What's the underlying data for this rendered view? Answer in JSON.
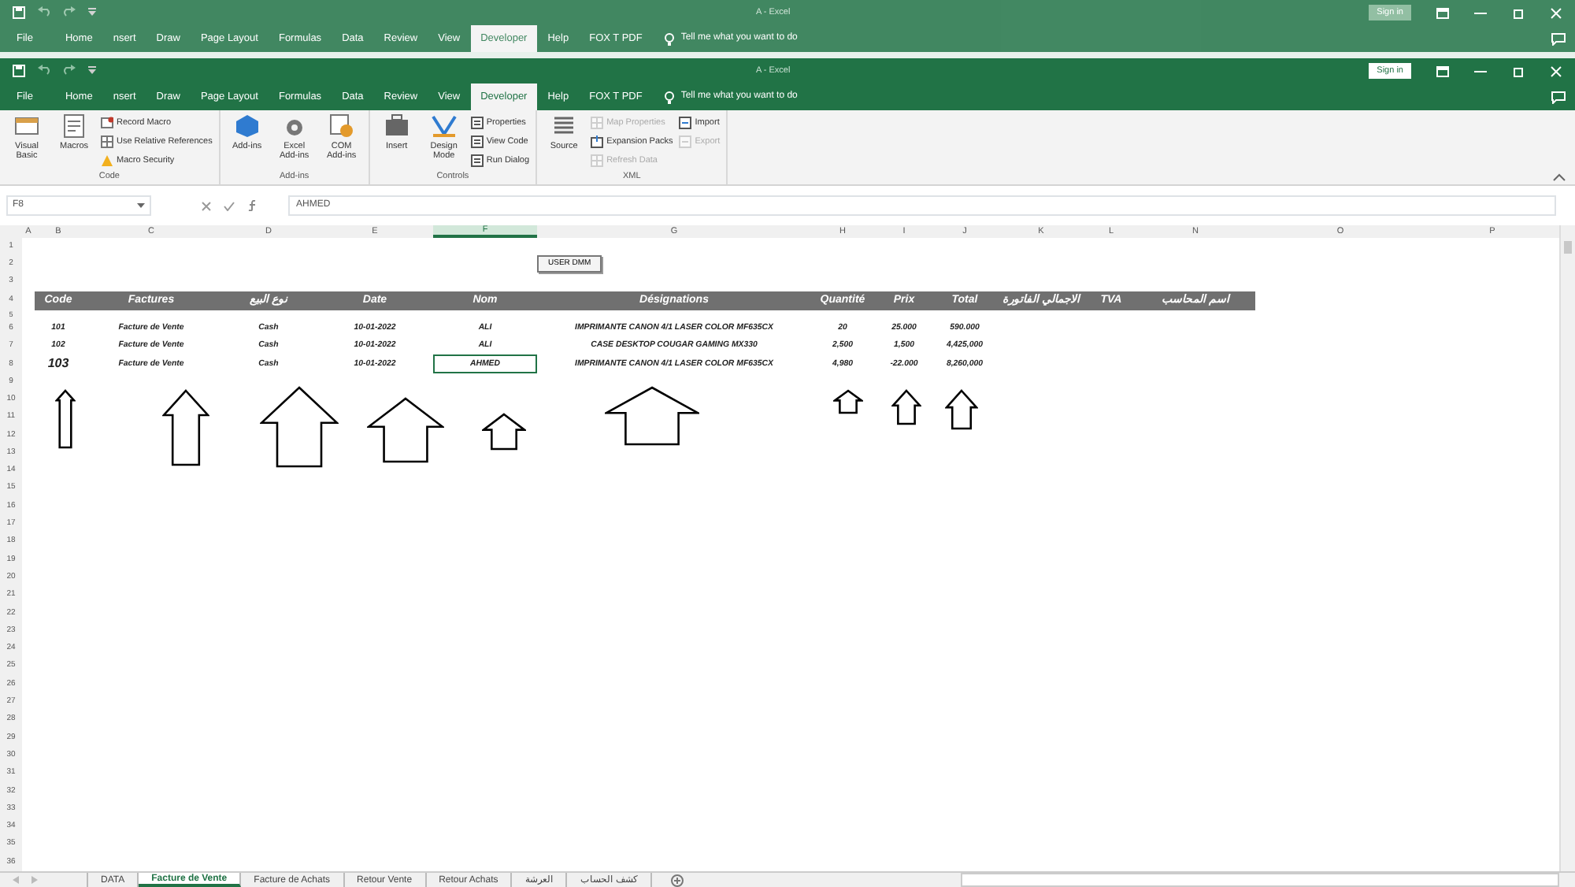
{
  "background_window": {
    "title": "A - Excel",
    "sign_in": "Sign in",
    "tell_me": "Tell me what you want to do",
    "tabs": [
      {
        "label": "File",
        "selected": false
      },
      {
        "label": "Home",
        "selected": false
      },
      {
        "label": "nsert",
        "selected": false
      },
      {
        "label": "Draw",
        "selected": false
      },
      {
        "label": "Page Layout",
        "selected": false
      },
      {
        "label": "Formulas",
        "selected": false
      },
      {
        "label": "Data",
        "selected": false
      },
      {
        "label": "Review",
        "selected": false
      },
      {
        "label": "View",
        "selected": false
      },
      {
        "label": "Developer",
        "selected": true
      },
      {
        "label": "Help",
        "selected": false
      },
      {
        "label": "FOX T PDF",
        "selected": false
      }
    ]
  },
  "window": {
    "title": "A - Excel",
    "sign_in": "Sign in",
    "tell_me": "Tell me what you want to do",
    "tabs": [
      {
        "label": "File",
        "selected": false
      },
      {
        "label": "Home",
        "selected": false
      },
      {
        "label": "nsert",
        "selected": false
      },
      {
        "label": "Draw",
        "selected": false
      },
      {
        "label": "Page Layout",
        "selected": false
      },
      {
        "label": "Formulas",
        "selected": false
      },
      {
        "label": "Data",
        "selected": false
      },
      {
        "label": "Review",
        "selected": false
      },
      {
        "label": "View",
        "selected": false
      },
      {
        "label": "Developer",
        "selected": true
      },
      {
        "label": "Help",
        "selected": false
      },
      {
        "label": "FOX T PDF",
        "selected": false
      }
    ]
  },
  "ribbon_groups": [
    {
      "label": "Code",
      "items": [
        {
          "label": "Visual Basic",
          "kind": "large",
          "disabled": false
        },
        {
          "label": "Macros",
          "kind": "large",
          "disabled": false
        },
        {
          "label": "Record Macro",
          "kind": "small",
          "disabled": false
        },
        {
          "label": "Use Relative References",
          "kind": "small",
          "disabled": false
        },
        {
          "label": "Macro Security",
          "kind": "small",
          "disabled": false
        }
      ]
    },
    {
      "label": "Add-ins",
      "items": [
        {
          "label": "Add-ins",
          "kind": "large",
          "disabled": false
        },
        {
          "label": "Excel Add-ins",
          "kind": "large",
          "disabled": false
        },
        {
          "label": "COM Add-ins",
          "kind": "large",
          "disabled": false
        }
      ]
    },
    {
      "label": "Controls",
      "items": [
        {
          "label": "Insert",
          "kind": "large",
          "disabled": false
        },
        {
          "label": "Design Mode",
          "kind": "large",
          "disabled": false
        },
        {
          "label": "Properties",
          "kind": "small",
          "disabled": false
        },
        {
          "label": "View Code",
          "kind": "small",
          "disabled": false
        },
        {
          "label": "Run Dialog",
          "kind": "small",
          "disabled": false
        }
      ]
    },
    {
      "label": "XML",
      "items": [
        {
          "label": "Source",
          "kind": "large",
          "disabled": false
        },
        {
          "label": "Map Properties",
          "kind": "small",
          "disabled": true
        },
        {
          "label": "Expansion Packs",
          "kind": "small",
          "disabled": false
        },
        {
          "label": "Refresh Data",
          "kind": "small",
          "disabled": true
        },
        {
          "label": "Import",
          "kind": "small",
          "disabled": false
        },
        {
          "label": "Export",
          "kind": "small",
          "disabled": true
        }
      ]
    }
  ],
  "name_box": "F8",
  "formula": "AHMED",
  "columns": [
    {
      "label": "A",
      "selected": false
    },
    {
      "label": "B",
      "selected": false
    },
    {
      "label": "C",
      "selected": false
    },
    {
      "label": "D",
      "selected": false
    },
    {
      "label": "E",
      "selected": false
    },
    {
      "label": "F",
      "selected": true
    },
    {
      "label": "G",
      "selected": false
    },
    {
      "label": "H",
      "selected": false
    },
    {
      "label": "I",
      "selected": false
    },
    {
      "label": "J",
      "selected": false
    },
    {
      "label": "K",
      "selected": false
    },
    {
      "label": "L",
      "selected": false
    },
    {
      "label": "N",
      "selected": false
    },
    {
      "label": "O",
      "selected": false
    },
    {
      "label": "P",
      "selected": false
    }
  ],
  "row_numbers": [
    "1",
    "2",
    "3",
    "4",
    "5",
    "6",
    "7",
    "8",
    "9",
    "10",
    "11",
    "12",
    "13",
    "14",
    "15",
    "16",
    "17",
    "18",
    "19",
    "20",
    "21",
    "22",
    "23",
    "24",
    "25",
    "26",
    "27",
    "28",
    "29",
    "30",
    "31",
    "32",
    "33",
    "34",
    "35",
    "36"
  ],
  "sheet_button": "USER DMM",
  "header_row": [
    "Code",
    "Factures",
    "نوع البيع",
    "Date",
    "Nom",
    "Désignations",
    "Quantité",
    "Prix",
    "Total",
    "الاجمالي الفاتورة",
    "TVA",
    "اسم المحاسب"
  ],
  "data_rows": [
    [
      {
        "text": "101",
        "selected": false,
        "large": false
      },
      {
        "text": "Facture de Vente",
        "selected": false,
        "large": false
      },
      {
        "text": "Cash",
        "selected": false,
        "large": false
      },
      {
        "text": "10-01-2022",
        "selected": false,
        "large": false
      },
      {
        "text": "ALI",
        "selected": false,
        "large": false
      },
      {
        "text": "IMPRIMANTE CANON 4/1 LASER COLOR MF635CX",
        "selected": false,
        "large": false
      },
      {
        "text": "20",
        "selected": false,
        "large": false
      },
      {
        "text": "25.000",
        "selected": false,
        "large": false
      },
      {
        "text": "590.000",
        "selected": false,
        "large": false
      }
    ],
    [
      {
        "text": "102",
        "selected": false,
        "large": false
      },
      {
        "text": "Facture de Vente",
        "selected": false,
        "large": false
      },
      {
        "text": "Cash",
        "selected": false,
        "large": false
      },
      {
        "text": "10-01-2022",
        "selected": false,
        "large": false
      },
      {
        "text": "ALI",
        "selected": false,
        "large": false
      },
      {
        "text": "CASE DESKTOP COUGAR GAMING MX330",
        "selected": false,
        "large": false
      },
      {
        "text": "2,500",
        "selected": false,
        "large": false
      },
      {
        "text": "1,500",
        "selected": false,
        "large": false
      },
      {
        "text": "4,425,000",
        "selected": false,
        "large": false
      }
    ],
    [
      {
        "text": "103",
        "selected": false,
        "large": true
      },
      {
        "text": "Facture de Vente",
        "selected": false,
        "large": false
      },
      {
        "text": "Cash",
        "selected": false,
        "large": false
      },
      {
        "text": "10-01-2022",
        "selected": false,
        "large": false
      },
      {
        "text": "AHMED",
        "selected": true,
        "large": false
      },
      {
        "text": "IMPRIMANTE CANON 4/1 LASER COLOR MF635CX",
        "selected": false,
        "large": false
      },
      {
        "text": "4,980",
        "selected": false,
        "large": false
      },
      {
        "text": "-22.000",
        "selected": false,
        "large": false
      },
      {
        "text": "8,260,000",
        "selected": false,
        "large": false
      }
    ]
  ],
  "sheet_tabs": [
    {
      "label": "DATA",
      "selected": false
    },
    {
      "label": "Facture de Vente",
      "selected": true
    },
    {
      "label": "Facture de Achats",
      "selected": false
    },
    {
      "label": "Retour Vente",
      "selected": false
    },
    {
      "label": "Retour Achats",
      "selected": false
    },
    {
      "label": "العرشة",
      "selected": false
    },
    {
      "label": "كشف الحساب",
      "selected": false
    }
  ]
}
